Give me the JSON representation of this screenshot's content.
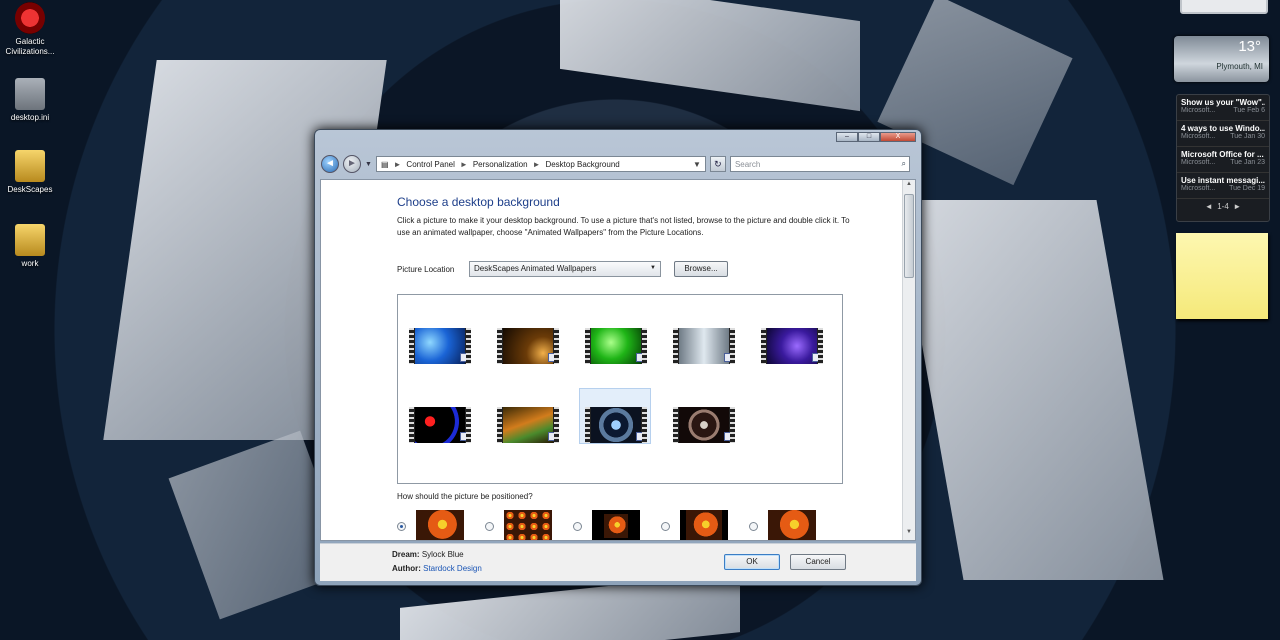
{
  "desktop": {
    "icons": [
      {
        "label": "Galactic Civilizations..."
      },
      {
        "label": "desktop.ini"
      },
      {
        "label": "DeskScapes"
      },
      {
        "label": "work"
      }
    ]
  },
  "gadgets": {
    "weather": {
      "temp": "13°",
      "city": "Plymouth, MI"
    },
    "news": {
      "items": [
        {
          "title": "Show us your \"Wow\"...",
          "source": "Microsoft...",
          "date": "Tue Feb 6"
        },
        {
          "title": "4 ways to use Windo...",
          "source": "Microsoft...",
          "date": "Tue Jan 30"
        },
        {
          "title": "Microsoft Office for ...",
          "source": "Microsoft...",
          "date": "Tue Jan 23"
        },
        {
          "title": "Use instant messagi...",
          "source": "Microsoft...",
          "date": "Tue Dec 19"
        }
      ],
      "page": "1-4"
    }
  },
  "window": {
    "caption_buttons": {
      "minimize": "–",
      "maximize": "□",
      "close": "X"
    },
    "nav": {
      "back": "◄",
      "forward": "►"
    },
    "breadcrumb": [
      "Control Panel",
      "Personalization",
      "Desktop Background"
    ],
    "search_placeholder": "Search",
    "heading": "Choose a desktop background",
    "description": "Click a picture to make it your desktop background. To use a picture that's not listed, browse to the picture and double click it. To use an animated wallpaper, choose \"Animated Wallpapers\" from the Picture Locations.",
    "picture_location_label": "Picture Location",
    "picture_location_value": "DeskScapes Animated Wallpapers",
    "browse_label": "Browse...",
    "position_question": "How should the picture be positioned?",
    "selected_position": 0,
    "selected_wallpaper": 7,
    "dream_label": "Dream:",
    "dream_value": "Sylock Blue",
    "author_label": "Author:",
    "author_value": "Stardock Design",
    "ok_label": "OK",
    "cancel_label": "Cancel"
  },
  "colors": {
    "heading": "#1e3f8a",
    "link": "#1a55b5"
  }
}
